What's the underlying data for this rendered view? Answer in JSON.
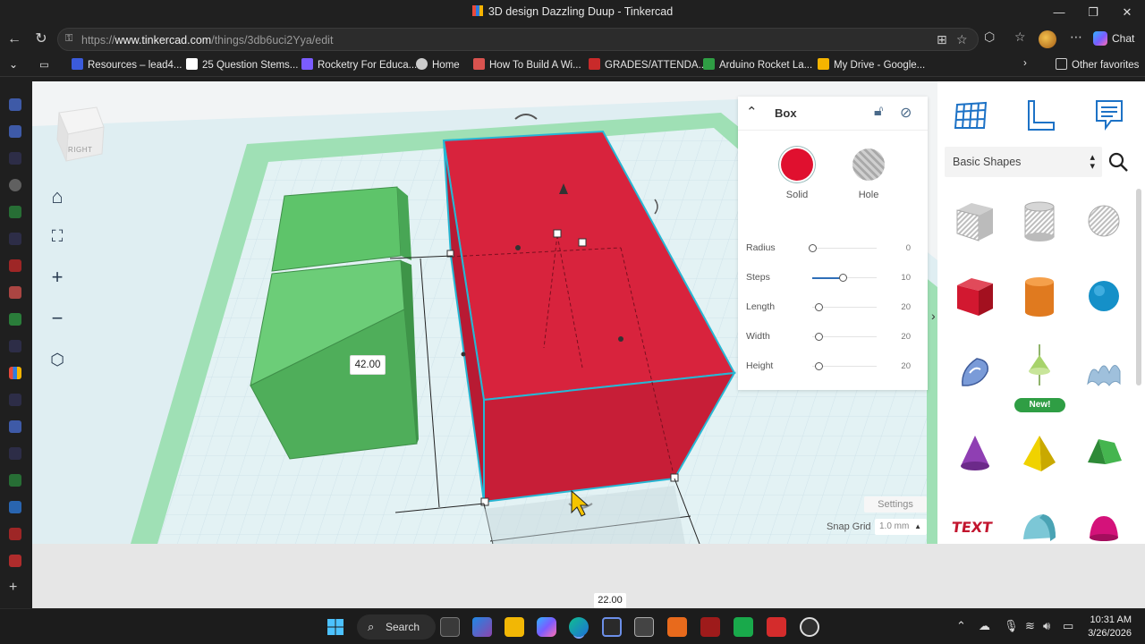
{
  "window": {
    "title": "3D design Dazzling Duup - Tinkercad",
    "minimize": "—",
    "maximize": "❐",
    "close": "✕"
  },
  "address_bar": {
    "protocol": "https://",
    "host": "www.tinkercad.com",
    "path": "/things/3db6uci2Yya/edit",
    "chat_label": "Chat"
  },
  "favorites": {
    "items": [
      {
        "label": "Resources – lead4...",
        "color": "#3b5bdb"
      },
      {
        "label": "25 Question Stems...",
        "color": "#ffffff"
      },
      {
        "label": "Rocketry For Educa...",
        "color": "#7b5cff"
      },
      {
        "label": "Home",
        "color": "#cccccc"
      },
      {
        "label": "How To Build A Wi...",
        "color": "#d9534f"
      },
      {
        "label": "GRADES/ATTENDA...",
        "color": "#c92a2a"
      },
      {
        "label": "Arduino Rocket La...",
        "color": "#2f9e44"
      },
      {
        "label": "My Drive - Google...",
        "color": "#f5b400"
      }
    ],
    "other_favorites": "Other favorites"
  },
  "viewcube": {
    "face_label": "RIGHT"
  },
  "scene": {
    "dimension_height": "42.00",
    "dimension_width": "22.00"
  },
  "inspector": {
    "shape_name": "Box",
    "solid_label": "Solid",
    "hole_label": "Hole",
    "solid_color": "#e0102f",
    "properties": [
      {
        "label": "Radius",
        "value": "0",
        "fill": 0.0
      },
      {
        "label": "Steps",
        "value": "10",
        "fill": 0.45
      },
      {
        "label": "Length",
        "value": "20",
        "fill": 0.05
      },
      {
        "label": "Width",
        "value": "20",
        "fill": 0.05
      },
      {
        "label": "Height",
        "value": "20",
        "fill": 0.05
      }
    ]
  },
  "settings": {
    "settings_label": "Settings",
    "snap_grid_label": "Snap Grid",
    "snap_grid_value": "1.0 mm"
  },
  "library": {
    "category": "Basic Shapes",
    "new_badge": "New!",
    "shapes": [
      "Box Hole",
      "Cylinder Hole",
      "Sphere Hole",
      "Box",
      "Cylinder",
      "Sphere",
      "Scribble",
      "Spinning Top",
      "Wave",
      "Cone",
      "Pyramid",
      "Roof",
      "Text",
      "Half Cylinder",
      "Paraboloid"
    ]
  },
  "taskbar": {
    "search_label": "Search",
    "time": "10:31 AM",
    "date": "3/26/2026"
  }
}
